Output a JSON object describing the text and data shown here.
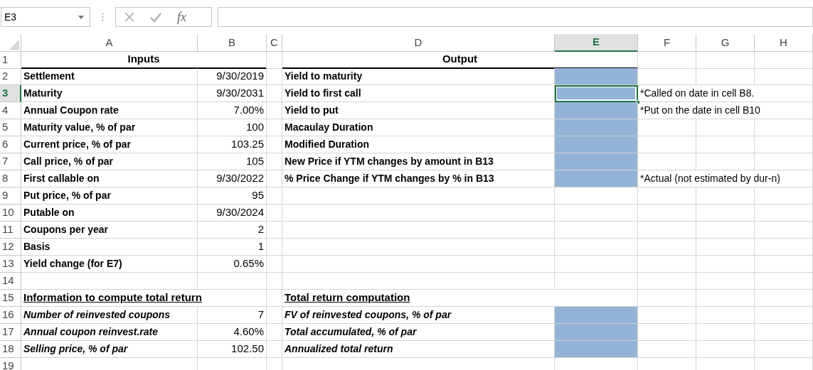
{
  "formula_bar": {
    "name_box": "E3",
    "fx_label": "fx"
  },
  "columns": [
    {
      "label": "A",
      "selected": false
    },
    {
      "label": "B",
      "selected": false
    },
    {
      "label": "C",
      "selected": false
    },
    {
      "label": "D",
      "selected": false
    },
    {
      "label": "E",
      "selected": true
    },
    {
      "label": "F",
      "selected": false
    },
    {
      "label": "G",
      "selected": false
    },
    {
      "label": "H",
      "selected": false
    }
  ],
  "rows": [
    {
      "number": "1",
      "selected": false,
      "col_a": {
        "kind": "header",
        "text": "Inputs"
      },
      "col_d": {
        "kind": "header",
        "text": "Output"
      }
    },
    {
      "number": "2",
      "selected": false,
      "col_a": {
        "kind": "label",
        "text": "Settlement"
      },
      "col_b": {
        "kind": "value",
        "text": "9/30/2019"
      },
      "col_d": {
        "kind": "label",
        "text": "Yield to maturity"
      },
      "col_e": {
        "kind": "output",
        "selected": false
      }
    },
    {
      "number": "3",
      "selected": true,
      "col_a": {
        "kind": "label",
        "text": "Maturity"
      },
      "col_b": {
        "kind": "value",
        "text": "9/30/2031"
      },
      "col_d": {
        "kind": "label",
        "text": "Yield to first call"
      },
      "col_e": {
        "kind": "output",
        "selected": true
      },
      "col_f": {
        "kind": "note",
        "text": "*Called on date in cell B8."
      }
    },
    {
      "number": "4",
      "selected": false,
      "col_a": {
        "kind": "label",
        "text": "Annual Coupon rate"
      },
      "col_b": {
        "kind": "value",
        "text": "7.00%"
      },
      "col_d": {
        "kind": "label",
        "text": "Yield to put"
      },
      "col_e": {
        "kind": "output",
        "selected": false
      },
      "col_f": {
        "kind": "note",
        "text": "*Put on the date in cell B10"
      }
    },
    {
      "number": "5",
      "selected": false,
      "col_a": {
        "kind": "label",
        "text": "Maturity value, % of par"
      },
      "col_b": {
        "kind": "value",
        "text": "100"
      },
      "col_d": {
        "kind": "label",
        "text": "Macaulay Duration"
      },
      "col_e": {
        "kind": "output",
        "selected": false
      }
    },
    {
      "number": "6",
      "selected": false,
      "col_a": {
        "kind": "label",
        "text": "Current price, % of par"
      },
      "col_b": {
        "kind": "value",
        "text": "103.25"
      },
      "col_d": {
        "kind": "label",
        "text": "Modified Duration"
      },
      "col_e": {
        "kind": "output",
        "selected": false
      }
    },
    {
      "number": "7",
      "selected": false,
      "col_a": {
        "kind": "label",
        "text": "Call price, % of par"
      },
      "col_b": {
        "kind": "value",
        "text": "105"
      },
      "col_d": {
        "kind": "label",
        "text": "New Price if YTM changes by amount in B13"
      },
      "col_e": {
        "kind": "output",
        "selected": false
      }
    },
    {
      "number": "8",
      "selected": false,
      "col_a": {
        "kind": "label",
        "text": "First callable on"
      },
      "col_b": {
        "kind": "value",
        "text": "9/30/2022"
      },
      "col_d": {
        "kind": "label",
        "text": "% Price Change if YTM changes by % in B13"
      },
      "col_e": {
        "kind": "output",
        "selected": false
      },
      "col_f": {
        "kind": "note",
        "text": "*Actual (not estimated by dur-n)"
      }
    },
    {
      "number": "9",
      "selected": false,
      "col_a": {
        "kind": "label",
        "text": "Put price, % of par"
      },
      "col_b": {
        "kind": "value",
        "text": "95"
      }
    },
    {
      "number": "10",
      "selected": false,
      "col_a": {
        "kind": "label",
        "text": "Putable on"
      },
      "col_b": {
        "kind": "value",
        "text": "9/30/2024"
      }
    },
    {
      "number": "11",
      "selected": false,
      "col_a": {
        "kind": "label",
        "text": "Coupons per year"
      },
      "col_b": {
        "kind": "value",
        "text": "2"
      }
    },
    {
      "number": "12",
      "selected": false,
      "col_a": {
        "kind": "label",
        "text": "Basis"
      },
      "col_b": {
        "kind": "value",
        "text": "1"
      }
    },
    {
      "number": "13",
      "selected": false,
      "col_a": {
        "kind": "label",
        "text": "Yield change (for E7)"
      },
      "col_b": {
        "kind": "value",
        "text": "0.65%"
      }
    },
    {
      "number": "14",
      "selected": false
    },
    {
      "number": "15",
      "selected": false,
      "col_a": {
        "kind": "section",
        "text": "Information to compute total return"
      },
      "col_d": {
        "kind": "section",
        "text": "Total return computation"
      }
    },
    {
      "number": "16",
      "selected": false,
      "col_a": {
        "kind": "italic_label",
        "text": "Number of reinvested coupons"
      },
      "col_b": {
        "kind": "value",
        "text": "7"
      },
      "col_d": {
        "kind": "italic_label",
        "text": "FV of reinvested coupons, % of par"
      },
      "col_e": {
        "kind": "output",
        "selected": false
      }
    },
    {
      "number": "17",
      "selected": false,
      "col_a": {
        "kind": "italic_label",
        "text": "Annual coupon reinvest.rate"
      },
      "col_b": {
        "kind": "value",
        "text": "4.60%"
      },
      "col_d": {
        "kind": "italic_label",
        "text": "Total accumulated, % of par"
      },
      "col_e": {
        "kind": "output",
        "selected": false
      }
    },
    {
      "number": "18",
      "selected": false,
      "col_a": {
        "kind": "italic_label",
        "text": "Selling price, % of par"
      },
      "col_b": {
        "kind": "value",
        "text": "102.50"
      },
      "col_d": {
        "kind": "italic_label",
        "text": "Annualized total return"
      },
      "col_e": {
        "kind": "output",
        "selected": false
      }
    },
    {
      "number": "19",
      "selected": false
    }
  ]
}
